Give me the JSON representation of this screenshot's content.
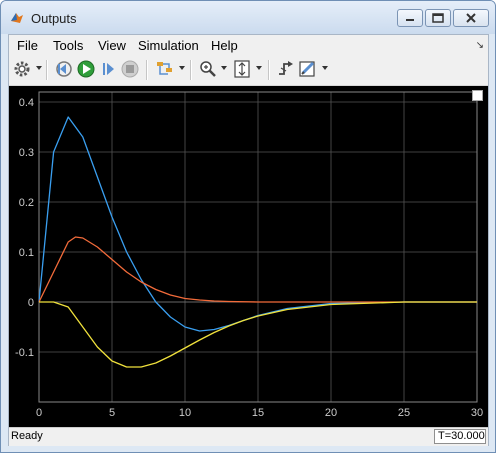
{
  "window": {
    "title": "Outputs"
  },
  "menu": {
    "items": [
      "File",
      "Tools",
      "View",
      "Simulation",
      "Help"
    ]
  },
  "toolbar": {
    "icons": [
      "settings-icon",
      "step-back-icon",
      "run-icon",
      "step-forward-icon",
      "stop-icon",
      "highlight-icon",
      "zoom-icon",
      "fit-axes-icon",
      "trigger-icon",
      "style-icon"
    ]
  },
  "status": {
    "ready": "Ready",
    "time": "T=30.000"
  },
  "colors": {
    "series1": "#3a9ff0",
    "series2": "#f26b3a",
    "series3": "#f0e13c",
    "background": "#000000",
    "grid": "#555555"
  },
  "chart_data": {
    "type": "line",
    "title": "",
    "xlabel": "",
    "ylabel": "",
    "xlim": [
      0,
      30
    ],
    "ylim": [
      -0.2,
      0.42
    ],
    "xticks": [
      0,
      5,
      10,
      15,
      20,
      25,
      30
    ],
    "yticks": [
      -0.1,
      0,
      0.1,
      0.2,
      0.3,
      0.4
    ],
    "grid": true,
    "series": [
      {
        "color": "#3a9ff0",
        "x": [
          0,
          0.5,
          1,
          2,
          3,
          4,
          5,
          6,
          7,
          8,
          9,
          10,
          11,
          12,
          13,
          14,
          15,
          17,
          20,
          25,
          30
        ],
        "y": [
          0,
          0.15,
          0.3,
          0.37,
          0.33,
          0.25,
          0.17,
          0.1,
          0.045,
          0.0,
          -0.03,
          -0.05,
          -0.058,
          -0.055,
          -0.047,
          -0.037,
          -0.027,
          -0.013,
          -0.003,
          0.0,
          0.0
        ]
      },
      {
        "color": "#f26b3a",
        "x": [
          0,
          1,
          2,
          2.5,
          3,
          4,
          5,
          6,
          7,
          8,
          9,
          10,
          11,
          12,
          13,
          15,
          20,
          25,
          30
        ],
        "y": [
          0,
          0.06,
          0.12,
          0.13,
          0.128,
          0.11,
          0.085,
          0.06,
          0.04,
          0.025,
          0.014,
          0.007,
          0.004,
          0.002,
          0.001,
          0.0,
          0.0,
          0.0,
          0.0
        ]
      },
      {
        "color": "#f0e13c",
        "x": [
          0,
          1,
          2,
          3,
          4,
          5,
          6,
          7,
          8,
          9,
          10,
          11,
          12,
          13,
          14,
          15,
          17,
          20,
          25,
          30
        ],
        "y": [
          0,
          0.0,
          -0.01,
          -0.05,
          -0.09,
          -0.118,
          -0.13,
          -0.13,
          -0.122,
          -0.108,
          -0.092,
          -0.076,
          -0.061,
          -0.048,
          -0.037,
          -0.028,
          -0.015,
          -0.005,
          0.0,
          0.0
        ]
      }
    ]
  }
}
